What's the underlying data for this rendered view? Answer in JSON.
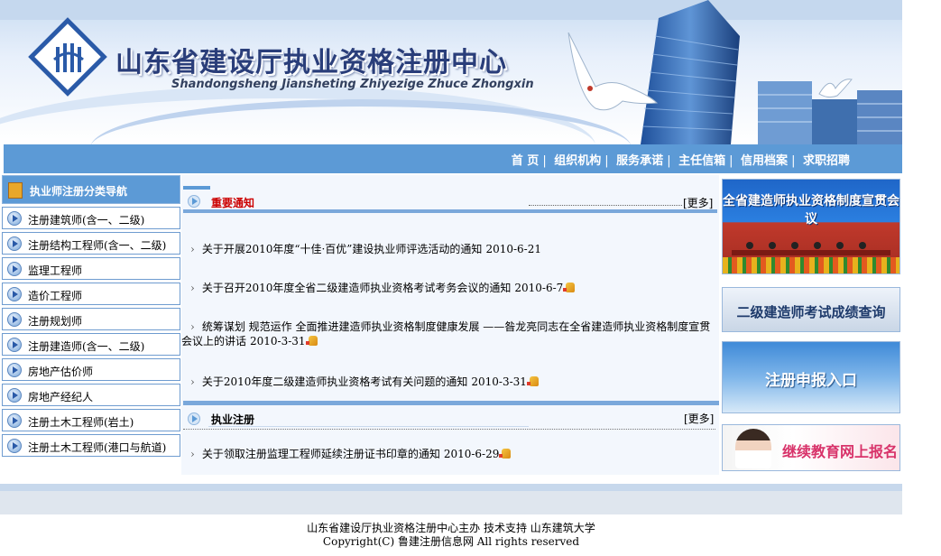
{
  "header": {
    "title_cn": "山东省建设厅执业资格注册中心",
    "title_en": "Shandongsheng Jiansheting Zhiyezige Zhuce Zhongxin"
  },
  "nav": {
    "items": [
      "首 页",
      "组织机构",
      "服务承诺",
      "主任信箱",
      "信用档案",
      "求职招聘"
    ],
    "separator": "|"
  },
  "sidebar": {
    "heading": "执业师注册分类导航",
    "items": [
      "注册建筑师(含一、二级)",
      "注册结构工程师(含一、二级)",
      "监理工程师",
      "造价工程师",
      "注册规划师",
      "注册建造师(含一、二级)",
      "房地产估价师",
      "房地产经纪人",
      "注册土木工程师(岩土)",
      "注册土木工程师(港口与航道)"
    ]
  },
  "notices": {
    "heading": "重要通知",
    "more": "[更多]",
    "items": [
      {
        "title": "关于开展2010年度“十佳·百优”建设执业师评选活动的通知",
        "date": "2010-6-21",
        "new": false
      },
      {
        "title": "关于召开2010年度全省二级建造师执业资格考试考务会议的通知",
        "date": "2010-6-7",
        "new": true
      },
      {
        "title": "统筹谋划 规范运作 全面推进建造师执业资格制度健康发展 ——昝龙亮同志在全省建造师执业资格制度宣贯会议上的讲话",
        "date": "2010-3-31",
        "new": true
      },
      {
        "title": "关于2010年度二级建造师执业资格考试有关问题的通知",
        "date": "2010-3-31",
        "new": true
      }
    ]
  },
  "registration": {
    "heading": "执业注册",
    "more": "[更多]",
    "items": [
      {
        "title": "关于领取注册监理工程师延续注册证书印章的通知",
        "date": "2010-6-29",
        "new": true
      }
    ]
  },
  "ads": {
    "ad1": "全省建造师执业资格制度宣贯会议",
    "ad2": "二级建造师考试成绩查询",
    "ad3": "注册申报入口",
    "ad4": "继续教育网上报名"
  },
  "footer": {
    "line1": "山东省建设厅执业资格注册中心主办 技术支持 山东建筑大学",
    "line2": "Copyright(C) 鲁建注册信息网 All rights reserved"
  },
  "colors": {
    "nav_bg": "#5c9ad6",
    "notice_heading": "#cc0000",
    "title": "#2a3e7a"
  }
}
